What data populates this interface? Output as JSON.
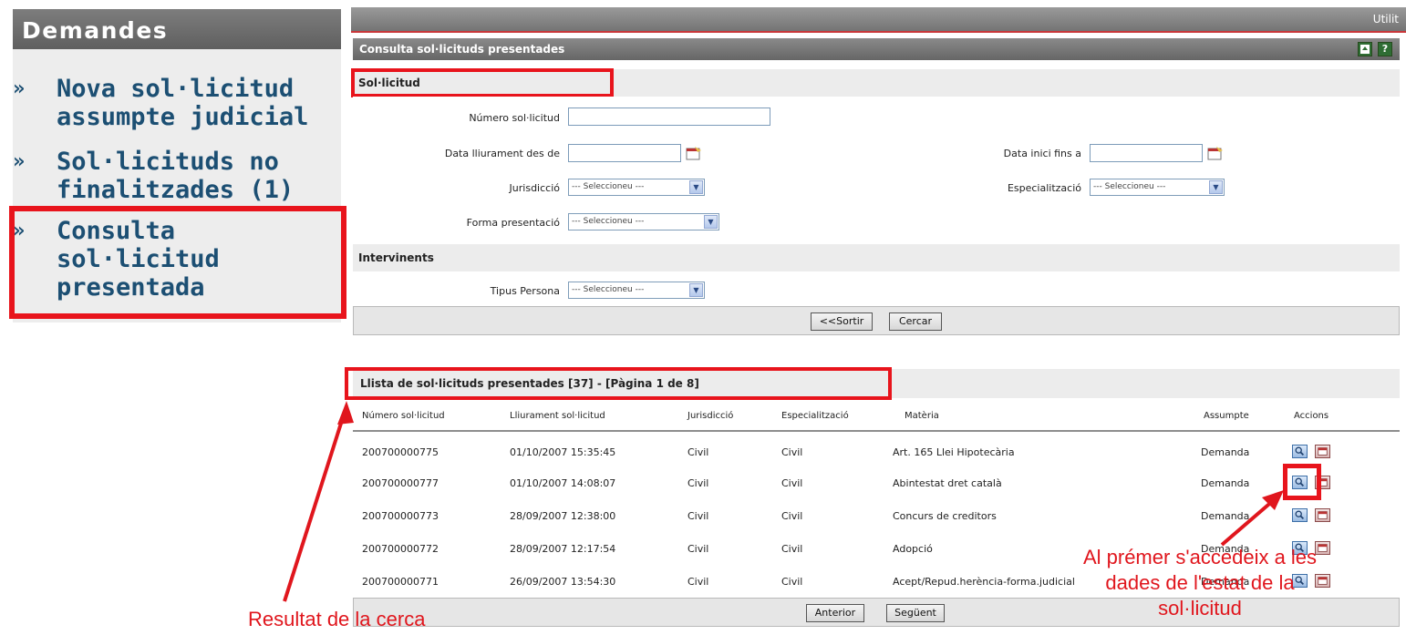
{
  "sidebar": {
    "title": "Demandes",
    "items": [
      {
        "chevron": "»",
        "label": "Nova sol·licitud assumpte judicial"
      },
      {
        "chevron": "»",
        "label": "Sol·licituds no finalitzades (1)"
      },
      {
        "chevron": "»",
        "label": "Consulta sol·licitud presentada"
      }
    ]
  },
  "topbar": {
    "right_text": "Utilit"
  },
  "panel": {
    "title": "Consulta sol·licituds presentades",
    "icons": [
      "export-icon",
      "help-icon"
    ],
    "help_glyph": "?"
  },
  "form": {
    "section_solicitud": "Sol·licitud",
    "numero_label": "Número sol·licitud",
    "numero_value": "",
    "data_lliurament_label": "Data lliurament des de",
    "data_lliurament_value": "",
    "data_inici_label": "Data inici fins a",
    "data_inici_value": "",
    "jurisdiccio_label": "Jurisdicció",
    "jurisdiccio_value": "--- Seleccioneu ---",
    "especialitzacio_label": "Especialització",
    "especialitzacio_value": "--- Seleccioneu ---",
    "forma_label": "Forma presentació",
    "forma_value": "--- Seleccioneu ---",
    "section_intervinents": "Intervinents",
    "tipus_label": "Tipus Persona",
    "tipus_value": "--- Seleccioneu ---",
    "sortir_label": "<<Sortir",
    "cercar_label": "Cercar"
  },
  "list": {
    "header": "Llista de sol·licituds presentades [37] - [Pàgina 1 de 8]",
    "columns": [
      "Número sol·licitud",
      "Lliurament sol·licitud",
      "Jurisdicció",
      "Especialització",
      "Matèria",
      "Assumpte",
      "Accions"
    ],
    "rows": [
      [
        "200700000775",
        "01/10/2007 15:35:45",
        "Civil",
        "Civil",
        "Art. 165 Llei Hipotecària",
        "Demanda"
      ],
      [
        "200700000777",
        "01/10/2007 14:08:07",
        "Civil",
        "Civil",
        "Abintestat dret català",
        "Demanda"
      ],
      [
        "200700000773",
        "28/09/2007 12:38:00",
        "Civil",
        "Civil",
        "Concurs de creditors",
        "Demanda"
      ],
      [
        "200700000772",
        "28/09/2007 12:17:54",
        "Civil",
        "Civil",
        "Adopció",
        "Demanda"
      ],
      [
        "200700000771",
        "26/09/2007 13:54:30",
        "Civil",
        "Civil",
        "Acept/Repud.herència-forma.judicial",
        "Demanda"
      ]
    ],
    "anterior_label": "Anterior",
    "seguent_label": "Següent"
  },
  "annotations": {
    "resultat": "Resultat de la cerca",
    "accedeix": "Al prémer s'accedeix a les dades de l'estat de la sol·licitud"
  },
  "colors": {
    "accent_red": "#e8141c",
    "menu_text": "#1c4f73",
    "annotation_red": "#e0161d"
  }
}
